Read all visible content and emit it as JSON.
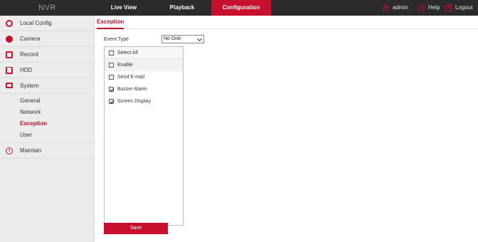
{
  "header": {
    "brand": "NVR",
    "nav": {
      "live_view": "Live View",
      "playback": "Playback",
      "configuration": "Configuration"
    },
    "user": "admin",
    "help": "Help",
    "logout": "Logout"
  },
  "sidebar": {
    "items": [
      {
        "label": "Local Config",
        "icon": "gear-icon"
      },
      {
        "label": "Camera",
        "icon": "camera-icon"
      },
      {
        "label": "Record",
        "icon": "record-icon"
      },
      {
        "label": "HDD",
        "icon": "hdd-icon"
      },
      {
        "label": "System",
        "icon": "monitor-icon"
      }
    ],
    "system_sub": [
      "General",
      "Network",
      "Exception",
      "User"
    ],
    "active_sub": "Exception",
    "maintain": {
      "label": "Maintain",
      "icon": "info-icon"
    }
  },
  "main": {
    "tab_title": "Exception",
    "event_type_label": "Event Type",
    "event_type_value": "No Disk",
    "select_all": "Select All",
    "options": [
      {
        "label": "Enable",
        "checked": false
      },
      {
        "label": "Send E-mail",
        "checked": false
      },
      {
        "label": "Buzzer Alarm",
        "checked": true
      },
      {
        "label": "Screen Display",
        "checked": true
      }
    ],
    "save_label": "Save"
  },
  "colors": {
    "accent": "#c8102e",
    "topbar": "#2b2b2b",
    "sidebar": "#ececec"
  }
}
